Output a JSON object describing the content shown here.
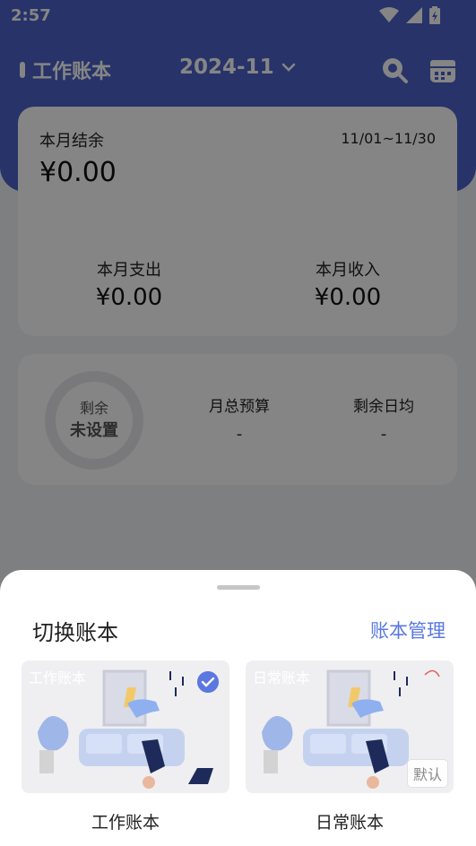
{
  "status_bar": {
    "time": "2:57"
  },
  "header": {
    "book_name": "工作账本",
    "month": "2024-11",
    "icons": [
      "search-icon",
      "calendar-icon"
    ]
  },
  "summary": {
    "balance_label": "本月结余",
    "date_range": "11/01~11/30",
    "balance": "¥0.00",
    "expense_label": "本月支出",
    "expense": "¥0.00",
    "income_label": "本月收入",
    "income": "¥0.00"
  },
  "budget": {
    "ring_label": "剩余",
    "ring_value": "未设置",
    "total_label": "月总预算",
    "total_value": "-",
    "daily_label": "剩余日均",
    "daily_value": "-"
  },
  "sheet": {
    "title": "切换账本",
    "manage_label": "账本管理",
    "books": [
      {
        "name": "工作账本",
        "cover_label": "工作账本",
        "selected": true
      },
      {
        "name": "日常账本",
        "cover_label": "日常账本",
        "badge": "默认"
      }
    ]
  },
  "colors": {
    "primary": "#4b63c9",
    "accent": "#5a78e0",
    "overlay": "rgba(0,0,0,0.48)"
  }
}
